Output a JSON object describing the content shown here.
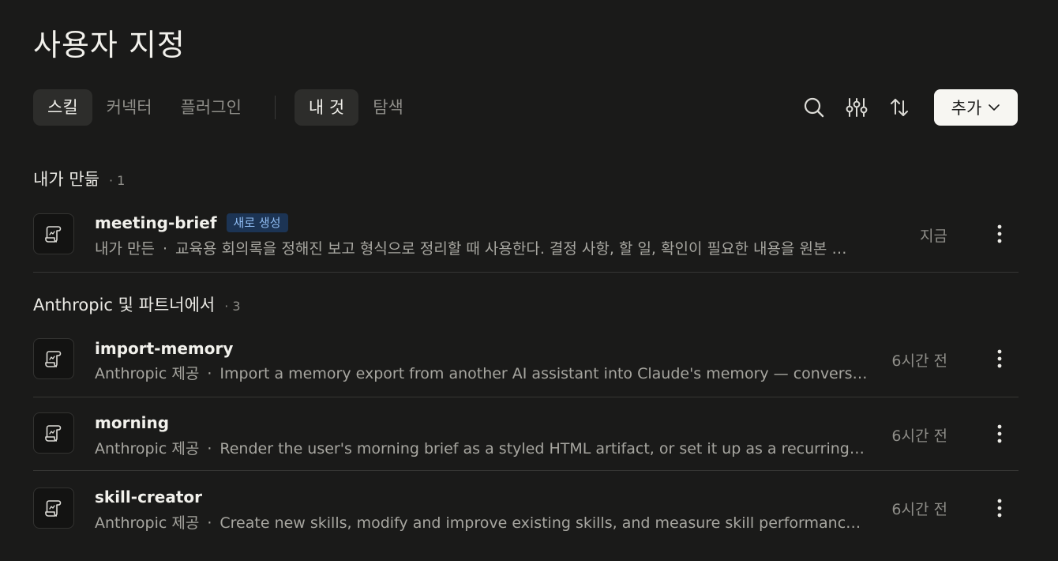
{
  "title": "사용자 지정",
  "tabs": [
    {
      "label": "스킬",
      "active": true
    },
    {
      "label": "커넥터",
      "active": false
    },
    {
      "label": "플러그인",
      "active": false
    }
  ],
  "filters": [
    {
      "label": "내 것",
      "active": true
    },
    {
      "label": "탐색",
      "active": false
    }
  ],
  "toolbar": {
    "search_icon": "search-icon",
    "filter_icon": "sliders-icon",
    "sort_icon": "sort-arrows-icon",
    "add_label": "추가"
  },
  "sections": [
    {
      "title": "내가 만듦",
      "count": "· 1",
      "items": [
        {
          "name": "meeting-brief",
          "badge": "새로 생성",
          "source": "내가 만든",
          "separator": "·",
          "description": "교육용 회의록을 정해진 보고 형식으로 정리할 때 사용한다. 결정 사항, 할 일, 확인이 필요한 내용을 원본 …",
          "time": "지금"
        }
      ]
    },
    {
      "title": "Anthropic 및 파트너에서",
      "count": "· 3",
      "items": [
        {
          "name": "import-memory",
          "source": "Anthropic 제공",
          "separator": "·",
          "description": "Import a memory export from another AI assistant into Claude's memory — conversation…",
          "time": "6시간 전"
        },
        {
          "name": "morning",
          "source": "Anthropic 제공",
          "separator": "·",
          "description": "Render the user's morning brief as a styled HTML artifact, or set it up as a recurring wee…",
          "time": "6시간 전"
        },
        {
          "name": "skill-creator",
          "source": "Anthropic 제공",
          "separator": "·",
          "description": "Create new skills, modify and improve existing skills, and measure skill performance. Us…",
          "time": "6시간 전"
        }
      ]
    }
  ],
  "colors": {
    "background": "#1a1a19",
    "active_tab": "#2d2d2b",
    "badge_bg": "#1c3454",
    "badge_text": "#8fbcf2",
    "add_button_bg": "#f7f6f2"
  }
}
